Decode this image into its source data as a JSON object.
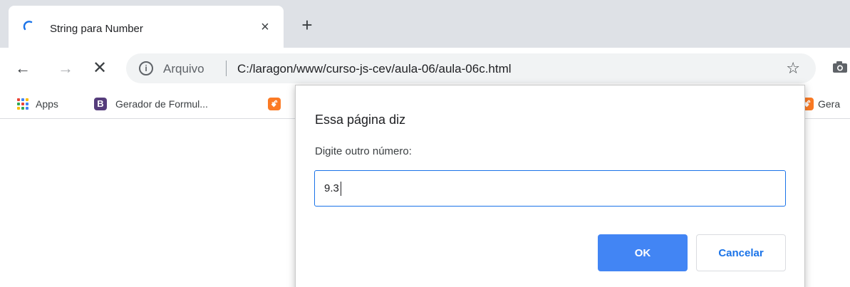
{
  "tab": {
    "title": "String para Number",
    "close_glyph": "×",
    "spinner_icon": "loading-spinner-icon"
  },
  "new_tab_glyph": "+",
  "toolbar": {
    "back_glyph": "←",
    "forward_glyph": "→",
    "stop_glyph": "✕",
    "info_glyph": "i",
    "origin_label": "Arquivo",
    "url": "C:/laragon/www/curso-js-cev/aula-06/aula-06c.html",
    "star_glyph": "☆"
  },
  "bookmarks": {
    "apps_label": "Apps",
    "gerador_badge": "B",
    "gerador_label": "Gerador de Formul...",
    "xampp_badge": "ꗄ",
    "gera_label": "Gera"
  },
  "dialog": {
    "title": "Essa página diz",
    "message": "Digite outro número:",
    "input_value": "9.3",
    "ok_label": "OK",
    "cancel_label": "Cancelar"
  },
  "colors": {
    "accent": "#4285f4",
    "link": "#1a73e8",
    "bootstrap_purple": "#563d7c",
    "xampp_orange": "#fb7a24"
  }
}
